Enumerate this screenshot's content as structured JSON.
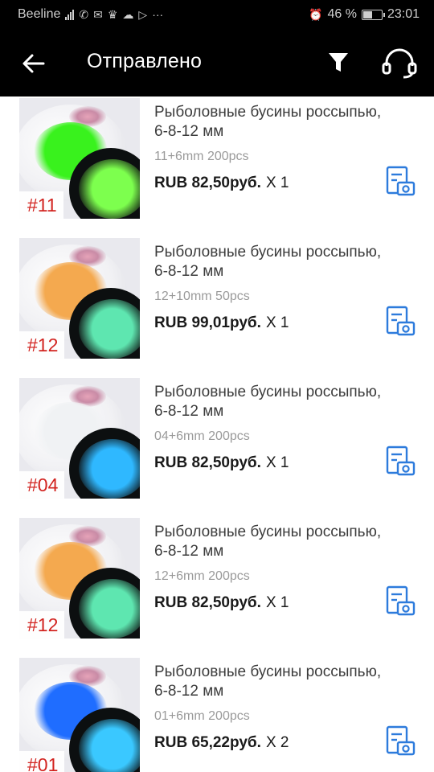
{
  "status_bar": {
    "carrier": "Beeline",
    "battery_percent": "46 %",
    "battery_level": 0.46,
    "time": "23:01",
    "more": "···"
  },
  "header": {
    "title": "Отправлено"
  },
  "items": [
    {
      "name_line1": "Рыболовные бусины россыпью,",
      "name_line2": "6-8-12 мм",
      "variant": "11+6mm 200pcs",
      "price": "RUB 82,50руб.",
      "qty": "X 1",
      "tag": "#11",
      "bead_color": "#39f21d",
      "glow_color": "#7dff4e"
    },
    {
      "name_line1": "Рыболовные бусины россыпью,",
      "name_line2": "6-8-12 мм",
      "variant": "12+10mm 50pcs",
      "price": "RUB 99,01руб.",
      "qty": "X 1",
      "tag": "#12",
      "bead_color": "#f4a94f",
      "glow_color": "#5ee6b0"
    },
    {
      "name_line1": "Рыболовные бусины россыпью,",
      "name_line2": "6-8-12 мм",
      "variant": "04+6mm 200pcs",
      "price": "RUB 82,50руб.",
      "qty": "X 1",
      "tag": "#04",
      "bead_color": "#f0f2f4",
      "glow_color": "#2fb8ff"
    },
    {
      "name_line1": "Рыболовные бусины россыпью,",
      "name_line2": "6-8-12 мм",
      "variant": "12+6mm 200pcs",
      "price": "RUB 82,50руб.",
      "qty": "X 1",
      "tag": "#12",
      "bead_color": "#f4a94f",
      "glow_color": "#5ee6b0"
    },
    {
      "name_line1": "Рыболовные бусины россыпью,",
      "name_line2": "6-8-12 мм",
      "variant": "01+6mm 200pcs",
      "price": "RUB 65,22руб.",
      "qty": "X 2",
      "tag": "#01",
      "bead_color": "#1f6dff",
      "glow_color": "#3ac8ff"
    }
  ],
  "colors": {
    "header_bg": "#000000",
    "header_text": "#ffffff",
    "accent_blue": "#2d7bdc",
    "tag_red": "#d2231f"
  },
  "icons": {
    "back": "arrow-left-icon",
    "filter": "filter-icon",
    "support": "headset-icon",
    "review": "photo-review-icon"
  }
}
